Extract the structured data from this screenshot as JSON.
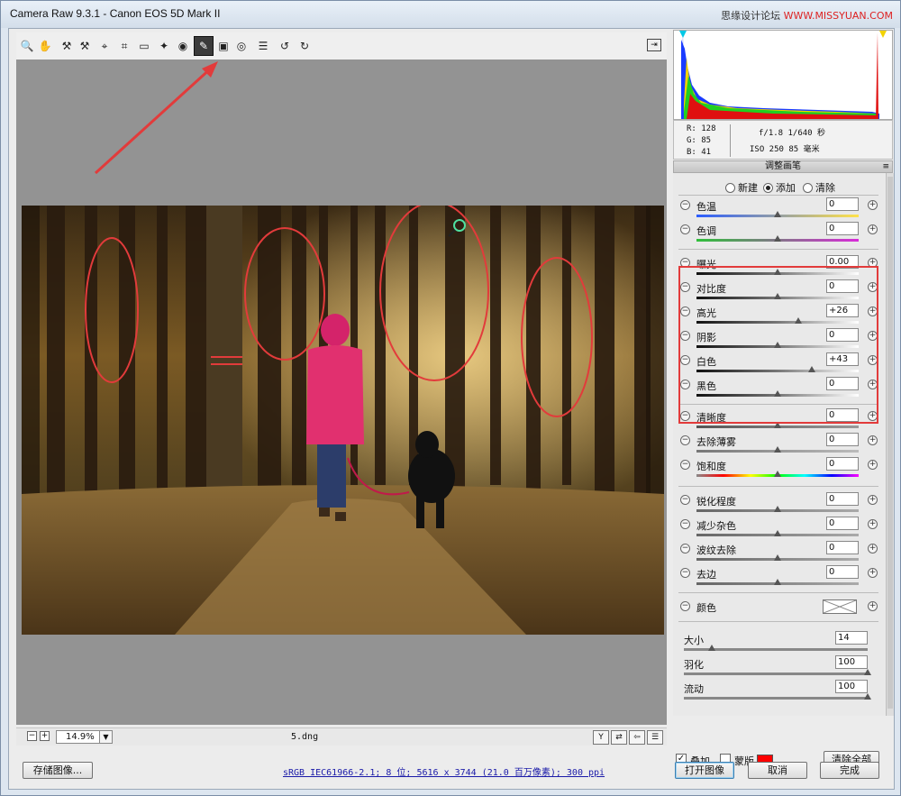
{
  "window": {
    "title": "Camera Raw 9.3.1 -  Canon EOS 5D Mark II",
    "watermark_a": "思缘设计论坛",
    "watermark_b": "WWW.MISSYUAN.COM"
  },
  "toolbar": {
    "tools": [
      "zoom-icon",
      "hand-icon",
      "white-balance-icon",
      "color-sampler-icon",
      "targeted-adjustment-icon",
      "crop-icon",
      "straighten-icon",
      "spot-removal-icon",
      "red-eye-icon",
      "adjustment-brush-icon",
      "graduated-filter-icon",
      "radial-filter-icon",
      "preferences-icon",
      "rotate-ccw-icon",
      "rotate-cw-icon"
    ],
    "active_tool": "adjustment-brush-icon"
  },
  "status": {
    "zoom": "14.9%",
    "filename": "5.dng"
  },
  "readout": {
    "r": "R:  128",
    "g": "G:  85",
    "b": "B:  41",
    "exposure": "f/1.8   1/640 秒",
    "iso": "ISO 250   85 毫米"
  },
  "panel": {
    "header": "调整画笔",
    "modes": [
      "新建",
      "添加",
      "清除"
    ],
    "selected_mode": "添加",
    "group1": [
      {
        "label": "色温",
        "value": "0",
        "pos": 0.5
      },
      {
        "label": "色调",
        "value": "0",
        "pos": 0.5
      }
    ],
    "group2": [
      {
        "label": "曝光",
        "value": "0.00",
        "pos": 0.5
      },
      {
        "label": "对比度",
        "value": "0",
        "pos": 0.5
      },
      {
        "label": "高光",
        "value": "+26",
        "pos": 0.63
      },
      {
        "label": "阴影",
        "value": "0",
        "pos": 0.5
      },
      {
        "label": "白色",
        "value": "+43",
        "pos": 0.71
      },
      {
        "label": "黑色",
        "value": "0",
        "pos": 0.5
      }
    ],
    "group3": [
      {
        "label": "清晰度",
        "value": "0",
        "pos": 0.5
      },
      {
        "label": "去除薄雾",
        "value": "0",
        "pos": 0.5
      },
      {
        "label": "饱和度",
        "value": "0",
        "pos": 0.5
      }
    ],
    "group4": [
      {
        "label": "锐化程度",
        "value": "0",
        "pos": 0.5
      },
      {
        "label": "减少杂色",
        "value": "0",
        "pos": 0.5
      },
      {
        "label": "波纹去除",
        "value": "0",
        "pos": 0.5
      },
      {
        "label": "去边",
        "value": "0",
        "pos": 0.5
      }
    ],
    "color_label": "颜色",
    "brush": [
      {
        "label": "大小",
        "value": "14",
        "pos": 0.15
      },
      {
        "label": "羽化",
        "value": "100",
        "pos": 1.0
      },
      {
        "label": "流动",
        "value": "100",
        "pos": 1.0
      }
    ]
  },
  "bottom_panel": {
    "overlay": "叠加",
    "mask": "蒙版",
    "clear_all": "清除全部",
    "overlay_checked": true,
    "mask_checked": false,
    "mask_color": "#ff0000"
  },
  "footer": {
    "save": "存储图像...",
    "info": "sRGB IEC61966-2.1; 8 位; 5616 x 3744 (21.0 百万像素); 300 ppi",
    "open": "打开图像",
    "cancel": "取消",
    "done": "完成"
  }
}
